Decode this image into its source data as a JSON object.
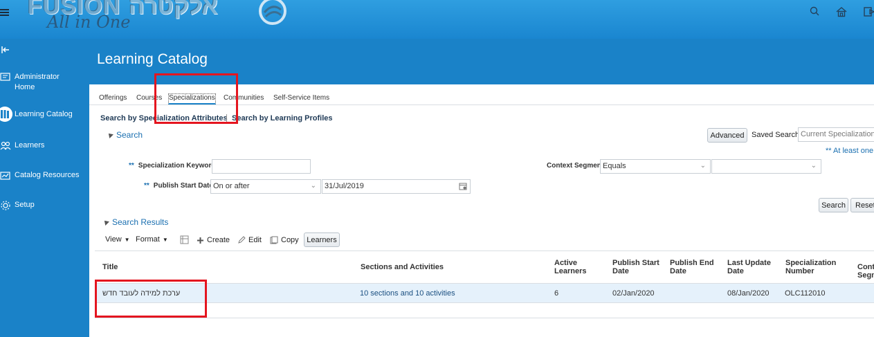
{
  "topbar": {
    "logo_latin": "FUSION",
    "logo_hebrew": "אלקטרה",
    "logo_tagline": "All in One",
    "icons": [
      "menu-icon",
      "search-icon",
      "home-icon",
      "navigator-icon"
    ]
  },
  "sidenav": {
    "items": [
      {
        "label": "Administrator Home",
        "icon": "admin-home-icon"
      },
      {
        "label": "Learning Catalog",
        "icon": "catalog-books-icon"
      },
      {
        "label": "Learners",
        "icon": "learners-icon"
      },
      {
        "label": "Catalog Resources",
        "icon": "catalog-resources-icon"
      },
      {
        "label": "Setup",
        "icon": "setup-gear-icon"
      }
    ]
  },
  "page": {
    "title": "Learning Catalog"
  },
  "tabs": [
    "Offerings",
    "Courses",
    "Specializations",
    "Communities",
    "Self-Service Items"
  ],
  "subtabs": [
    "Search by Specialization Attributes",
    "Search by Learning Profiles"
  ],
  "search": {
    "section_label": "Search",
    "advanced_label": "Advanced",
    "saved_search_label": "Saved Search",
    "saved_search_value": "Current Specializations",
    "at_least_one": "** At least one",
    "required_marker": "**",
    "keyword_label": "Specialization Keyword",
    "keyword_value": "",
    "publish_start_label": "Publish Start Date",
    "publish_start_operator": "On or after",
    "publish_start_value": "31/Jul/2019",
    "context_segment_label": "Context Segment",
    "context_segment_operator": "Equals",
    "context_segment_value": "",
    "search_button": "Search",
    "reset_button": "Reset"
  },
  "results": {
    "section_label": "Search Results",
    "toolbar": {
      "view": "View",
      "format": "Format",
      "create": "Create",
      "edit": "Edit",
      "copy": "Copy",
      "learners": "Learners"
    },
    "columns": [
      "Title",
      "Sections and Activities",
      "Active Learners",
      "Publish Start Date",
      "Publish End Date",
      "Last Update Date",
      "Specialization Number",
      "Cont Segm"
    ],
    "rows": [
      {
        "title": "ערכת למידה לעובד חדש",
        "sections": "10 sections and 10 activities",
        "active_learners": "6",
        "publish_start": "02/Jan/2020",
        "publish_end": "",
        "last_update": "08/Jan/2020",
        "number": "OLC112010"
      }
    ]
  },
  "colors": {
    "brand_blue": "#1a82c8",
    "highlight_red": "#e4151f",
    "selected_row": "#e5f1fb",
    "link_blue": "#1a6fb0"
  }
}
